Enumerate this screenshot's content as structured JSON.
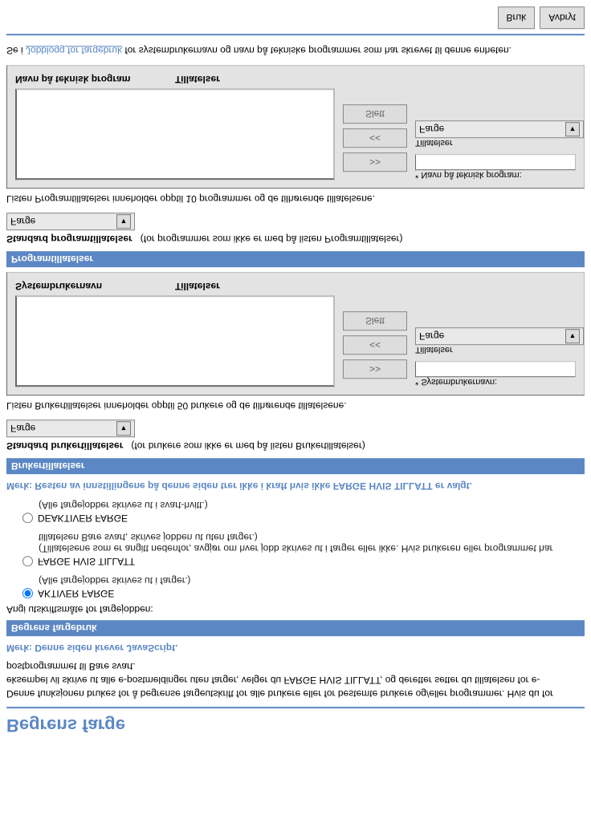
{
  "title": "Begrens farge",
  "intro": "Denne funksjonen brukes for å begrense fargeutskrift for alle brukere eller for bestemte brukere og/eller programmer. Hvis du for eksempel vil skrive ut alle e-postmeldinger uten farger, velger du FARGE HVIS TILLATT, og deretter setter du tillatelsen for e-postprogrammet til Bare svart.",
  "jsnote": "Merk: Denne siden krever JavaScript.",
  "sec1": "Begrens fargebruk",
  "instr": "Angi utskriftsmåte for fargejobben:",
  "r1": "AKTIVER FARGE",
  "r1sub": "(Alle fargejobber skrives ut i farger.)",
  "r2": "FARGE HVIS TILLATT",
  "r2sub": "(Tillatelsene som er angitt nedenfor, avgjør om hver jobb skrives ut i farger eller ikke. Hvis brukeren eller programmet har tillatelsen Bare svart, skrives jobben ut uten farger.)",
  "r3": "DEAKTIVER FARGE",
  "r3sub": "(Alle fargejobber skrives ut i svart-hvitt.)",
  "note2": "Merk: Resten av innstillingene på denne siden trer ikke i kraft hvis ikke FARGE HVIS TILLATT er valgt.",
  "sec2": "Brukertillatelser",
  "stdUser": "Standard brukertillatelser",
  "stdUserHint": "(for brukere som ikke er med på listen Brukertillatelser)",
  "farge": "Farge",
  "userListDesc": "Listen Brukertillatelser inneholder opptil 50 brukere og de tilhørende tillatelsene.",
  "colUser": "Systembrukernavn",
  "colPerm": "Tillatelser",
  "btnAdd": ">>",
  "btnRem": "<<",
  "btnDel": "Slett",
  "fldUser": "* Systembrukernavn:",
  "fldPerm": "Tillatelser",
  "sec3": "Programtillatelser",
  "stdProg": "Standard programtillatelser",
  "stdProgHint": "(for programmer som ikke er med på listen Programtillatelser)",
  "progListDesc": "Listen Programtillatelser inneholder opptil 10 programmer og de tilhørende tillatelsene.",
  "colProg": "Navn på teknisk program",
  "fldProg": "* Navn på teknisk program:",
  "footPre": "Se i ",
  "footLink": "Jobblogg for fargebruk",
  "footPost": " for systembrukernavn og navn på tekniske programmer som har skrevet til denne enheten.",
  "apply": "Bruk",
  "cancel": "Avbryt"
}
